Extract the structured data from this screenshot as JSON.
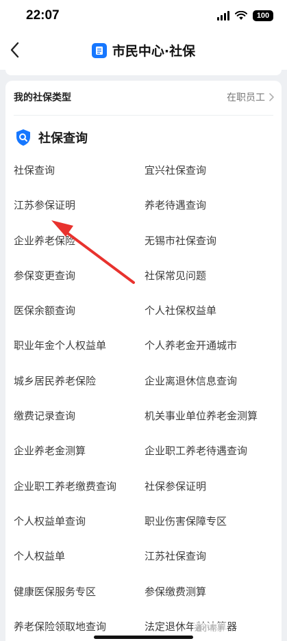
{
  "status": {
    "time": "22:07",
    "battery": "100"
  },
  "nav": {
    "title": "市民中心·社保"
  },
  "insurance_type": {
    "label": "我的社保类型",
    "value": "在职员工"
  },
  "section": {
    "title": "社保查询"
  },
  "items": [
    "社保查询",
    "宜兴社保查询",
    "江苏参保证明",
    "养老待遇查询",
    "企业养老保险",
    "无锡市社保查询",
    "参保变更查询",
    "社保常见问题",
    "医保余额查询",
    "个人社保权益单",
    "职业年金个人权益单",
    "个人养老金开通城市",
    "城乡居民养老保险",
    "企业离退休信息查询",
    "缴费记录查询",
    "机关事业单位养老金测算",
    "企业养老金测算",
    "企业职工养老待遇查询",
    "企业职工养老缴费查询",
    "社保参保证明",
    "个人权益单查询",
    "职业伤害保障专区",
    "个人权益单",
    "江苏社保查询",
    "健康医保服务专区",
    "参保缴费测算",
    "养老保险领取地查询",
    "法定退休年龄计算器"
  ],
  "watermark": "通小帮手",
  "colors": {
    "accent": "#1677ff",
    "arrow": "#e8322e"
  },
  "icons": [
    "back-chevron-icon",
    "document-icon",
    "search-shield-icon",
    "chevron-right-icon"
  ]
}
